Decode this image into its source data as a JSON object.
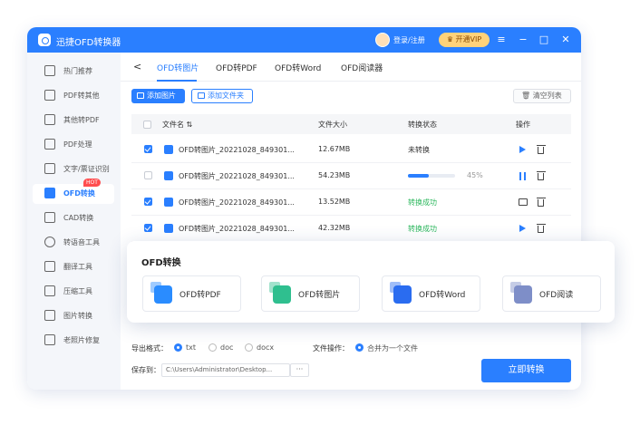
{
  "app": {
    "title": "迅捷OFD转换器",
    "login": "登录/注册",
    "vip": "开通VIP"
  },
  "window_controls": {
    "menu": "≡",
    "minimize": "−",
    "maximize": "□",
    "close": "✕"
  },
  "sidebar": {
    "items": [
      {
        "label": "热门推荐"
      },
      {
        "label": "PDF转其他"
      },
      {
        "label": "其他转PDF"
      },
      {
        "label": "PDF处理"
      },
      {
        "label": "文字/票证识别"
      },
      {
        "label": "OFD转换",
        "badge": "HOT",
        "active": true
      },
      {
        "label": "CAD转换"
      },
      {
        "label": "转语音工具"
      },
      {
        "label": "翻译工具"
      },
      {
        "label": "压缩工具"
      },
      {
        "label": "图片转换"
      },
      {
        "label": "老照片修复"
      }
    ]
  },
  "tabs": {
    "back": "<",
    "items": [
      {
        "label": "OFD转图片",
        "active": true
      },
      {
        "label": "OFD转PDF"
      },
      {
        "label": "OFD转Word"
      },
      {
        "label": "OFD阅读器"
      }
    ]
  },
  "toolbar": {
    "add_image": "添加图片",
    "add_folder": "添加文件夹",
    "clear_list": "清空列表"
  },
  "table": {
    "headers": {
      "name": "文件名 ⇅",
      "size": "文件大小",
      "status": "转换状态",
      "actions": "操作"
    },
    "rows": [
      {
        "name": "OFD转图片_20221028_849301...",
        "size": "12.67MB",
        "status": "未转换",
        "checked": true
      },
      {
        "name": "OFD转图片_20221028_849301...",
        "size": "54.23MB",
        "progress_text": "45%",
        "progress": 0.45,
        "checked": false
      },
      {
        "name": "OFD转图片_20221028_849301...",
        "size": "13.52MB",
        "status": "转换成功",
        "checked": true
      },
      {
        "name": "OFD转图片_20221028_849301...",
        "size": "42.32MB",
        "status": "转换成功",
        "checked": true
      }
    ]
  },
  "popup": {
    "title": "OFD转换",
    "cards": [
      {
        "label": "OFD转PDF",
        "icon": "pdf-icon"
      },
      {
        "label": "OFD转图片",
        "icon": "image-icon"
      },
      {
        "label": "OFD转Word",
        "icon": "word-icon"
      },
      {
        "label": "OFD阅读",
        "icon": "reader-icon"
      }
    ]
  },
  "bottom": {
    "format_label": "导出格式：",
    "formats": [
      "txt",
      "doc",
      "docx"
    ],
    "selected_format": "txt",
    "file_op_label": "文件操作：",
    "file_op": "合并为一个文件",
    "save_label": "保存到：",
    "save_path": "C:\\Users\\Administrator\\Desktop...",
    "browse": "···",
    "convert": "立即转换"
  },
  "colors": {
    "accent": "#2a7fff",
    "success": "#2db85e",
    "hot": "#ff4d4f",
    "vip": "#ffd27a"
  }
}
